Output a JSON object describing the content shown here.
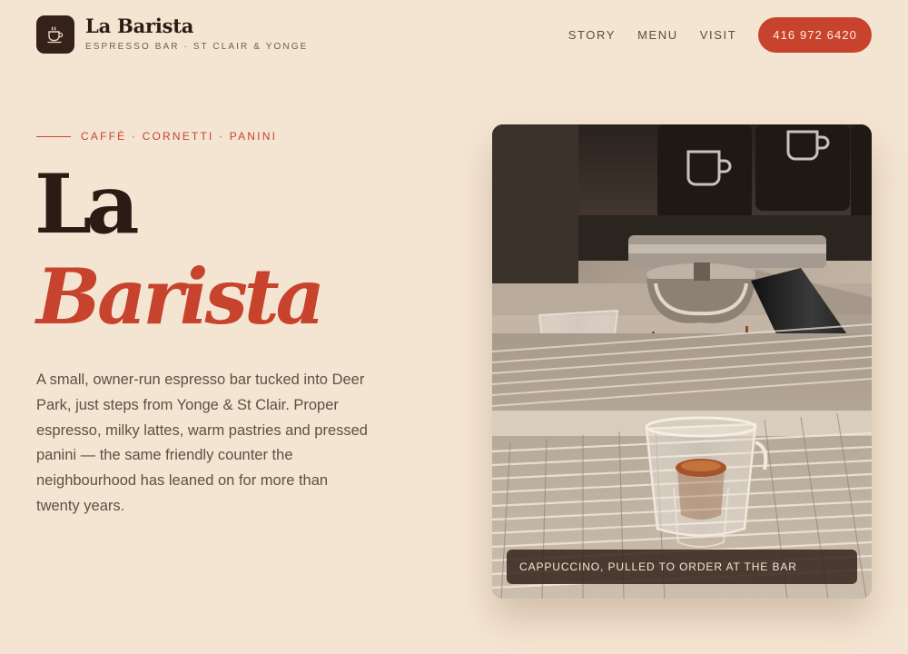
{
  "brand": {
    "name": "La Barista",
    "tagline": "ESPRESSO BAR · ST CLAIR & YONGE",
    "logo_icon": "coffee-cup-icon"
  },
  "nav": {
    "links": [
      "STORY",
      "MENU",
      "VISIT"
    ],
    "phone": "416 972 6420"
  },
  "hero": {
    "eyebrow": "CAFFÈ · CORNETTI · PANINI",
    "title_line1": "La",
    "title_line2": "Barista",
    "intro": "A small, owner-run espresso bar tucked into Deer Park, just steps from Yonge & St Clair. Proper espresso, milky lattes, warm pastries and pressed panini — the same friendly counter the neighbourhood has leaned on for more than twenty years.",
    "photo_caption": "CAPPUCCINO, PULLED TO ORDER AT THE BAR"
  },
  "colors": {
    "background": "#f4e5d2",
    "accent": "#c8432d",
    "ink": "#2a1b14",
    "body_text": "#5e4f45"
  }
}
